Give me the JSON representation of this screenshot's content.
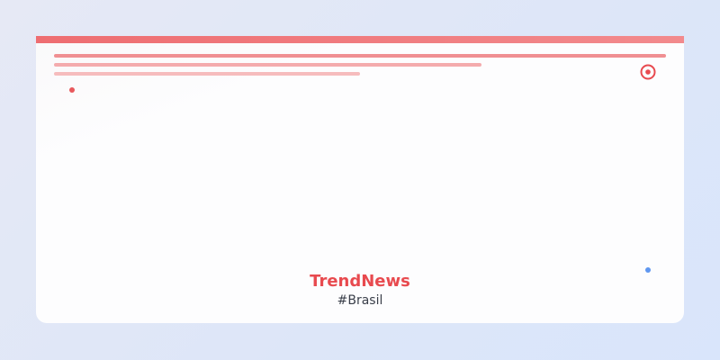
{
  "card": {
    "brand_name": "TrendNews",
    "hashtag": "#Brasil"
  },
  "icons": {
    "target": "target-icon"
  },
  "colors": {
    "accent": "#e84a4f",
    "top_bar": "#ee6d71",
    "dot_red": "#e8585c",
    "dot_blue": "#5f97f0",
    "text_dark": "#3a3f4a"
  }
}
